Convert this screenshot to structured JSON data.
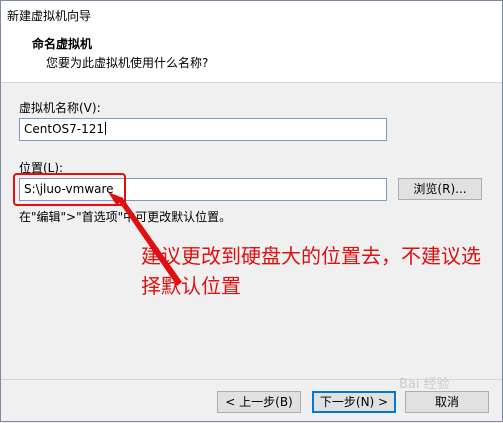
{
  "window": {
    "title": "新建虚拟机向导"
  },
  "header": {
    "title": "命名虚拟机",
    "subtitle": "您要为此虚拟机使用什么名称?"
  },
  "vm_name": {
    "label": "虚拟机名称(V):",
    "value": "CentOS7-121"
  },
  "location": {
    "label": "位置(L):",
    "value": "S:\\jluo-vmware",
    "browse_label": "浏览(R)...",
    "hint": "在\"编辑\">\"首选项\"中可更改默认位置。"
  },
  "annotation": {
    "text": "建议更改到硬盘大的位置去，不建议选择默认位置"
  },
  "footer": {
    "back_label": "< 上一步(B)",
    "next_label": "下一步(N) >",
    "cancel_label": "取消"
  },
  "watermark": {
    "text": "Bai 经验"
  },
  "colors": {
    "annotation": "#e01010",
    "accent": "#0078d7"
  }
}
